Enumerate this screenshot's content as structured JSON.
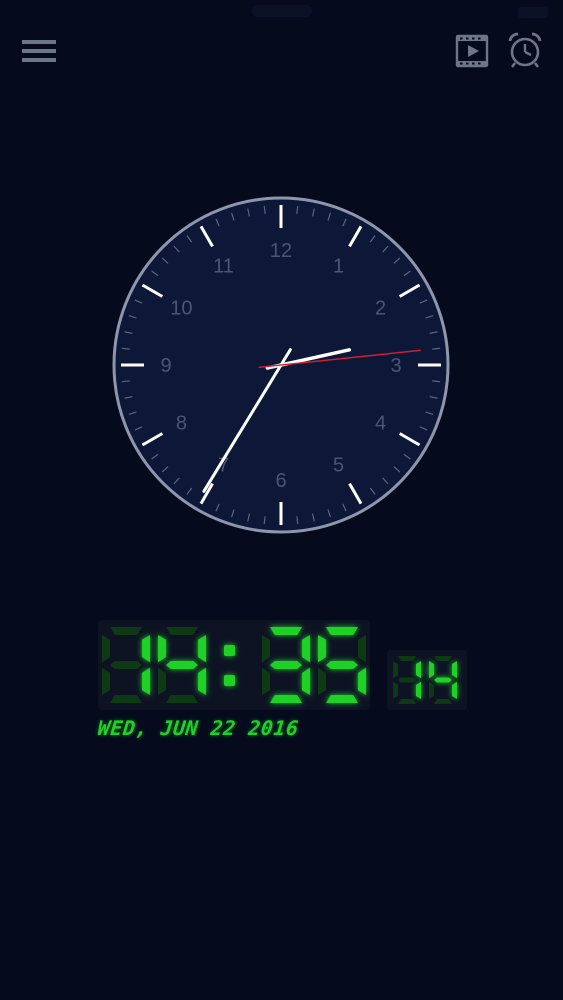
{
  "colors": {
    "background": "#050a1c",
    "clock_face": "#0d1838",
    "clock_rim": "#8e96ac",
    "numeral": "#495673",
    "tick": "#ffffff",
    "hand": "#ffffff",
    "second_hand": "#d61e2e",
    "lcd_on": "#1fd126",
    "lcd_off": "#0d3a14"
  },
  "icons": {
    "menu": "hamburger-menu-icon",
    "video": "video-play-icon",
    "alarm": "alarm-clock-icon"
  },
  "analog_clock": {
    "numerals": [
      "12",
      "1",
      "2",
      "3",
      "4",
      "5",
      "6",
      "7",
      "8",
      "9",
      "10",
      "11"
    ],
    "hour": 2,
    "minute": 35,
    "second": 14
  },
  "digital_clock": {
    "hours": "14",
    "separator": ":",
    "minutes": "35",
    "seconds": "14"
  },
  "date_text": "WED, JUN 22 2016"
}
